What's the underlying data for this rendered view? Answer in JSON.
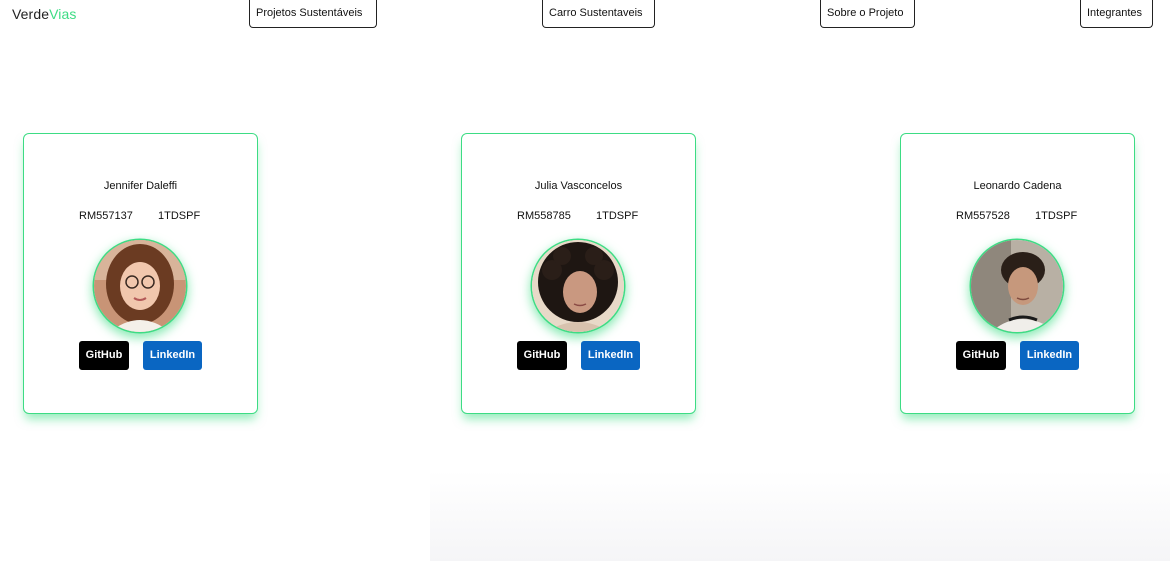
{
  "brand": {
    "part1": "Verde",
    "part2": "Vias",
    "accent": "#3ddc84"
  },
  "nav": {
    "items": [
      {
        "label": "Projetos Sustentáveis"
      },
      {
        "label": "Carro Sustentaveis"
      },
      {
        "label": "Sobre o Projeto"
      },
      {
        "label": "Integrantes"
      }
    ]
  },
  "members": [
    {
      "name": "Jennifer Daleffi",
      "rm": "RM557137",
      "class": "1TDSPF",
      "github_label": "GitHub",
      "linkedin_label": "LinkedIn"
    },
    {
      "name": "Julia Vasconcelos",
      "rm": "RM558785",
      "class": "1TDSPF",
      "github_label": "GitHub",
      "linkedin_label": "LinkedIn"
    },
    {
      "name": "Leonardo Cadena",
      "rm": "RM557528",
      "class": "1TDSPF",
      "github_label": "GitHub",
      "linkedin_label": "LinkedIn"
    }
  ],
  "colors": {
    "github": "#000000",
    "linkedin": "#0a66c2",
    "card_border": "#3ddc84"
  }
}
